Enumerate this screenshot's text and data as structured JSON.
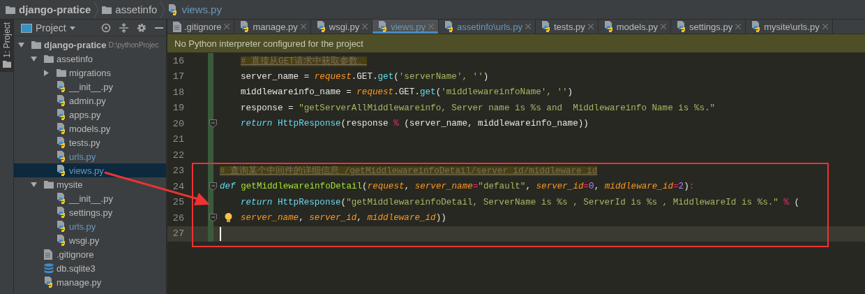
{
  "breadcrumbs": [
    {
      "label": "django-pratice",
      "kind": "folder",
      "modified": false
    },
    {
      "label": "assetinfo",
      "kind": "folder",
      "modified": false
    },
    {
      "label": "views.py",
      "kind": "python",
      "modified": true
    }
  ],
  "tool_strip": {
    "label": "1: Project"
  },
  "project_panel": {
    "title": "Project",
    "tree": [
      {
        "label": "django-pratice",
        "path": "D:\\pythonProjec",
        "kind": "folder",
        "expanded": true,
        "selected": false,
        "children": [
          {
            "label": "assetinfo",
            "kind": "folder",
            "expanded": true,
            "selected": false,
            "children": [
              {
                "label": "migrations",
                "kind": "folder",
                "expanded": false,
                "selected": false
              },
              {
                "label": "__init__.py",
                "kind": "python",
                "selected": false,
                "modified": false
              },
              {
                "label": "admin.py",
                "kind": "python",
                "selected": false,
                "modified": false
              },
              {
                "label": "apps.py",
                "kind": "python",
                "selected": false,
                "modified": false
              },
              {
                "label": "models.py",
                "kind": "python",
                "selected": false,
                "modified": false
              },
              {
                "label": "tests.py",
                "kind": "python",
                "selected": false,
                "modified": false
              },
              {
                "label": "urls.py",
                "kind": "python",
                "selected": false,
                "modified": true
              },
              {
                "label": "views.py",
                "kind": "python",
                "selected": true,
                "modified": true
              }
            ]
          },
          {
            "label": "mysite",
            "kind": "folder",
            "expanded": true,
            "selected": false,
            "children": [
              {
                "label": "__init__.py",
                "kind": "python",
                "selected": false,
                "modified": false
              },
              {
                "label": "settings.py",
                "kind": "python",
                "selected": false,
                "modified": false
              },
              {
                "label": "urls.py",
                "kind": "python",
                "selected": false,
                "modified": true
              },
              {
                "label": "wsgi.py",
                "kind": "python",
                "selected": false,
                "modified": false
              }
            ]
          },
          {
            "label": ".gitignore",
            "kind": "text",
            "selected": false,
            "modified": false
          },
          {
            "label": "db.sqlite3",
            "kind": "database",
            "selected": false,
            "modified": false
          },
          {
            "label": "manage.py",
            "kind": "python",
            "selected": false,
            "modified": false
          }
        ]
      }
    ]
  },
  "tabs": [
    {
      "label": ".gitignore",
      "kind": "text",
      "selected": false,
      "modified": false
    },
    {
      "label": "manage.py",
      "kind": "python",
      "selected": false,
      "modified": false
    },
    {
      "label": "wsgi.py",
      "kind": "python",
      "selected": false,
      "modified": false
    },
    {
      "label": "views.py",
      "kind": "python",
      "selected": true,
      "modified": true
    },
    {
      "label": "assetinfo\\urls.py",
      "kind": "python",
      "selected": false,
      "modified": true
    },
    {
      "label": "tests.py",
      "kind": "python",
      "selected": false,
      "modified": false
    },
    {
      "label": "models.py",
      "kind": "python",
      "selected": false,
      "modified": false
    },
    {
      "label": "settings.py",
      "kind": "python",
      "selected": false,
      "modified": false
    },
    {
      "label": "mysite\\urls.py",
      "kind": "python",
      "selected": false,
      "modified": false
    }
  ],
  "notice": "No Python interpreter configured for the project",
  "editor": {
    "lines": [
      {
        "number": "16",
        "changed": true,
        "fold": false,
        "bulb": false,
        "current": false,
        "indented": true,
        "tokens": [
          {
            "kind": "comment",
            "text": "# 直接从GET请求中获取参数。"
          }
        ]
      },
      {
        "number": "17",
        "changed": true,
        "fold": false,
        "bulb": false,
        "current": false,
        "indented": true,
        "tokens": [
          {
            "kind": "plain",
            "text": "server_name = "
          },
          {
            "kind": "param",
            "text": "request"
          },
          {
            "kind": "plain",
            "text": ".GET."
          },
          {
            "kind": "call",
            "text": "get"
          },
          {
            "kind": "plain",
            "text": "("
          },
          {
            "kind": "string",
            "text": "'serverName', ''"
          },
          {
            "kind": "plain",
            "text": ")"
          }
        ]
      },
      {
        "number": "18",
        "changed": true,
        "fold": false,
        "bulb": false,
        "current": false,
        "indented": true,
        "tokens": [
          {
            "kind": "plain",
            "text": "middlewareinfo_name = "
          },
          {
            "kind": "param",
            "text": "request"
          },
          {
            "kind": "plain",
            "text": ".GET."
          },
          {
            "kind": "call",
            "text": "get"
          },
          {
            "kind": "plain",
            "text": "("
          },
          {
            "kind": "string",
            "text": "'middlewareinfoName', ''"
          },
          {
            "kind": "plain",
            "text": ")"
          }
        ]
      },
      {
        "number": "19",
        "changed": true,
        "fold": false,
        "bulb": false,
        "current": false,
        "indented": true,
        "tokens": [
          {
            "kind": "plain",
            "text": "response = "
          },
          {
            "kind": "string",
            "text": "\"getServerAllMiddlewareinfo, Server name is %s and  Middlewareinfo Name is %s.\""
          }
        ]
      },
      {
        "number": "20",
        "changed": true,
        "fold": true,
        "bulb": false,
        "current": false,
        "indented": true,
        "tokens": [
          {
            "kind": "keyword",
            "text": "return "
          },
          {
            "kind": "builtin",
            "text": "HttpResponse"
          },
          {
            "kind": "plain",
            "text": "(response "
          },
          {
            "kind": "op",
            "text": "%"
          },
          {
            "kind": "plain",
            "text": " (server_name, middlewareinfo_name))"
          }
        ]
      },
      {
        "number": "21",
        "changed": true,
        "fold": false,
        "bulb": false,
        "current": false
      },
      {
        "number": "22",
        "changed": true,
        "fold": false,
        "bulb": false,
        "current": false
      },
      {
        "number": "23",
        "changed": true,
        "fold": false,
        "bulb": false,
        "current": false,
        "indented": false,
        "tokens": [
          {
            "kind": "comment",
            "text": "# 查询某个中间件的详细信息 /getMiddlewareinfoDetail/server_id/middleware_id"
          }
        ]
      },
      {
        "number": "24",
        "changed": true,
        "fold": true,
        "bulb": false,
        "current": false,
        "indented": false,
        "tokens": [
          {
            "kind": "keyword",
            "text": "def "
          },
          {
            "kind": "func",
            "text": "getMiddlewareinfoDetail"
          },
          {
            "kind": "plain",
            "text": "("
          },
          {
            "kind": "param",
            "text": "request"
          },
          {
            "kind": "plain",
            "text": ", "
          },
          {
            "kind": "param",
            "text": "server_name"
          },
          {
            "kind": "op",
            "text": "="
          },
          {
            "kind": "string",
            "text": "\"default\""
          },
          {
            "kind": "plain",
            "text": ", "
          },
          {
            "kind": "param",
            "text": "server_id"
          },
          {
            "kind": "op",
            "text": "="
          },
          {
            "kind": "number",
            "text": "0"
          },
          {
            "kind": "plain",
            "text": ", "
          },
          {
            "kind": "param",
            "text": "middleware_id"
          },
          {
            "kind": "op",
            "text": "="
          },
          {
            "kind": "number",
            "text": "2"
          },
          {
            "kind": "plain",
            "text": ")"
          },
          {
            "kind": "op",
            "text": ":"
          }
        ]
      },
      {
        "number": "25",
        "changed": true,
        "fold": false,
        "bulb": false,
        "current": false,
        "indented": true,
        "tokens": [
          {
            "kind": "keyword",
            "text": "return "
          },
          {
            "kind": "builtin",
            "text": "HttpResponse"
          },
          {
            "kind": "plain",
            "text": "("
          },
          {
            "kind": "string",
            "text": "\"getMiddlewareinfoDetail, ServerName is %s , ServerId is %s , MiddlewareId is %s.\""
          },
          {
            "kind": "op",
            "text": " %"
          },
          {
            "kind": "plain",
            "text": " ("
          }
        ]
      },
      {
        "number": "26",
        "changed": true,
        "fold": true,
        "bulb": true,
        "current": false,
        "indented": true,
        "tokens": [
          {
            "kind": "param",
            "text": "server_name"
          },
          {
            "kind": "plain",
            "text": ", "
          },
          {
            "kind": "param",
            "text": "server_id"
          },
          {
            "kind": "plain",
            "text": ", "
          },
          {
            "kind": "param",
            "text": "middleware_id"
          },
          {
            "kind": "plain",
            "text": "))"
          }
        ]
      },
      {
        "number": "27",
        "changed": true,
        "fold": false,
        "bulb": false,
        "current": true
      }
    ]
  }
}
